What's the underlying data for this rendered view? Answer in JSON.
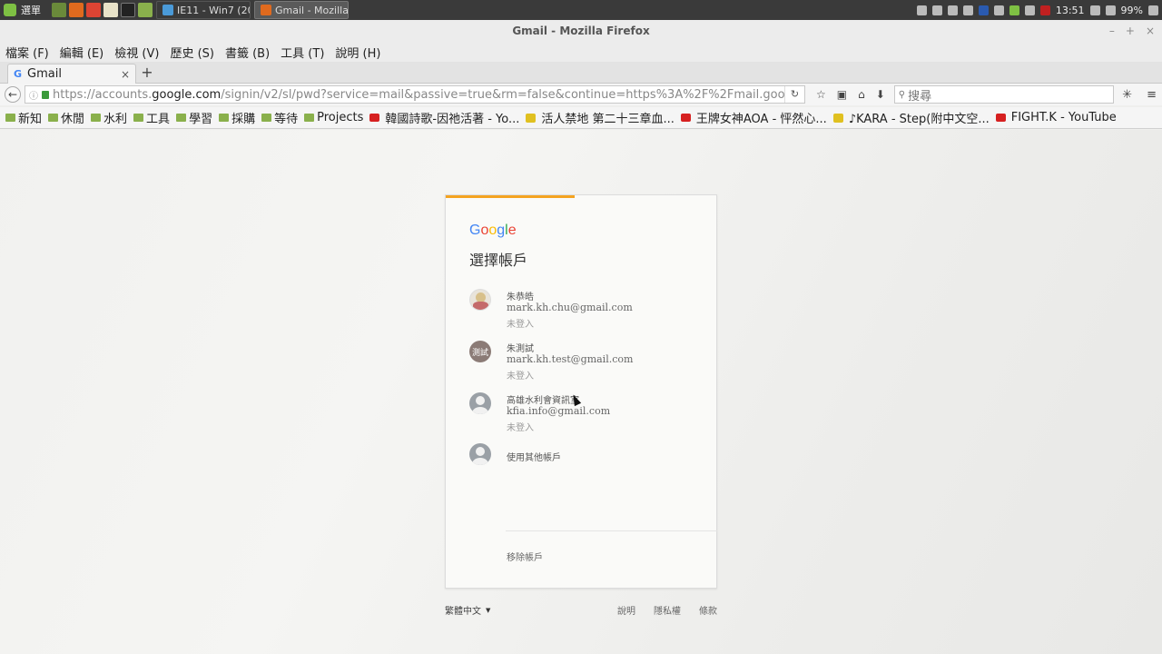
{
  "taskbar": {
    "start_label": "選單",
    "tasks": [
      {
        "label": "IE11 - Win7 (20...",
        "active": false
      },
      {
        "label": "Gmail - Mozilla...",
        "active": true
      }
    ],
    "clock": "13:51",
    "battery": "99%"
  },
  "window": {
    "title": "Gmail - Mozilla Firefox",
    "minimize": "–",
    "maximize": "+",
    "close": "×"
  },
  "menu": [
    "檔案 (F)",
    "編輯 (E)",
    "檢視 (V)",
    "歷史 (S)",
    "書籤 (B)",
    "工具 (T)",
    "說明 (H)"
  ],
  "tab": {
    "label": "Gmail",
    "close": "×",
    "new": "+"
  },
  "nav": {
    "url_prefix": "https://accounts.",
    "url_host": "google.com",
    "url_rest": "/signin/v2/sl/pwd?service=mail&passive=true&rm=false&continue=https%3A%2F%2Fmail.google.co",
    "search_placeholder": "搜尋"
  },
  "bookmarks": [
    {
      "label": "新知",
      "type": "folder"
    },
    {
      "label": "休閒",
      "type": "folder"
    },
    {
      "label": "水利",
      "type": "folder"
    },
    {
      "label": "工具",
      "type": "folder"
    },
    {
      "label": "學習",
      "type": "folder"
    },
    {
      "label": "採購",
      "type": "folder"
    },
    {
      "label": "等待",
      "type": "folder"
    },
    {
      "label": "Projects",
      "type": "folder"
    },
    {
      "label": "韓國詩歌-因祂活著 - Yo...",
      "type": "youtube"
    },
    {
      "label": "活人禁地 第二十三章血...",
      "type": "misc"
    },
    {
      "label": "王牌女神AOA - 怦然心...",
      "type": "youtube"
    },
    {
      "label": "♪KARA - Step(附中文空...",
      "type": "misc"
    },
    {
      "label": "FIGHT.K - YouTube",
      "type": "youtube"
    }
  ],
  "card": {
    "logo_letters": [
      "G",
      "o",
      "o",
      "g",
      "l",
      "e"
    ],
    "heading": "選擇帳戶",
    "accounts": [
      {
        "name": "朱恭皓",
        "email": "mark.kh.chu@gmail.com",
        "status": "未登入",
        "avatar": "photo"
      },
      {
        "name": "朱測試",
        "email": "mark.kh.test@gmail.com",
        "status": "未登入",
        "avatar": "測試"
      },
      {
        "name": "高雄水利會資訊室",
        "email": "kfia.info@gmail.com",
        "status": "未登入",
        "avatar": "person"
      }
    ],
    "other_account": "使用其他帳戶",
    "remove_account": "移除帳戶"
  },
  "footer": {
    "language": "繁體中文",
    "links": [
      "說明",
      "隱私權",
      "條款"
    ]
  },
  "colors": {
    "progress": "#f4a320",
    "page_bg": "#efefed",
    "card_bg": "#fafaf8"
  }
}
